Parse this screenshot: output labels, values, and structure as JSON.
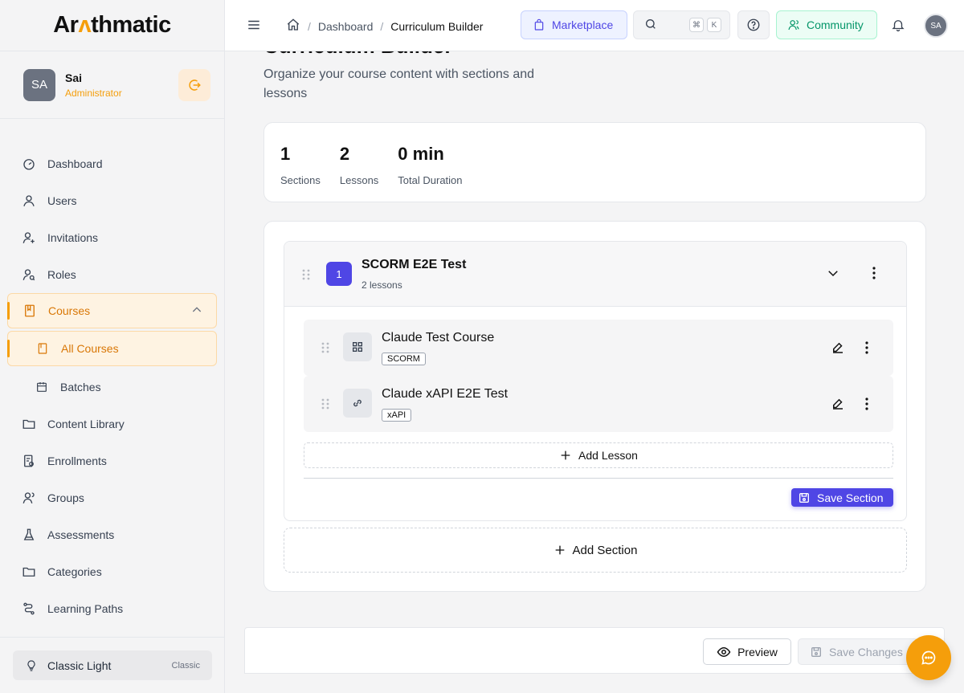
{
  "app": {
    "logo_prefix": "Ar",
    "logo_mark": "ʌ",
    "logo_suffix": "thmatic"
  },
  "profile": {
    "initials": "SA",
    "name": "Sai",
    "role": "Administrator"
  },
  "sidebar": {
    "items": [
      {
        "label": "Dashboard",
        "icon": "dashboard-icon"
      },
      {
        "label": "Users",
        "icon": "user-icon"
      },
      {
        "label": "Invitations",
        "icon": "user-plus-icon"
      },
      {
        "label": "Roles",
        "icon": "roles-icon"
      },
      {
        "label": "Courses",
        "icon": "book-icon"
      },
      {
        "label": "All Courses",
        "icon": "book-icon"
      },
      {
        "label": "Batches",
        "icon": "calendar-icon"
      },
      {
        "label": "Content Library",
        "icon": "folder-icon"
      },
      {
        "label": "Enrollments",
        "icon": "enrollment-icon"
      },
      {
        "label": "Groups",
        "icon": "group-icon"
      },
      {
        "label": "Assessments",
        "icon": "flask-icon"
      },
      {
        "label": "Categories",
        "icon": "folder-icon"
      },
      {
        "label": "Learning Paths",
        "icon": "path-icon"
      }
    ],
    "theme": {
      "label": "Classic Light",
      "tag": "Classic"
    }
  },
  "header": {
    "breadcrumbs": [
      "Dashboard",
      "Curriculum Builder"
    ],
    "marketplace": "Marketplace",
    "kbd1": "⌘",
    "kbd2": "K",
    "community": "Community",
    "avatar": "SA"
  },
  "page": {
    "title": "Curriculum Builder",
    "description": "Organize your course content with sections and lessons"
  },
  "stats": [
    {
      "value": "1",
      "label": "Sections"
    },
    {
      "value": "2",
      "label": "Lessons"
    },
    {
      "value": "0 min",
      "label": "Total Duration"
    }
  ],
  "section": {
    "number": "1",
    "title": "SCORM E2E Test",
    "subtitle": "2 lessons",
    "lessons": [
      {
        "title": "Claude Test Course",
        "type": "SCORM",
        "icon": "grid-icon"
      },
      {
        "title": "Claude xAPI E2E Test",
        "type": "xAPI",
        "icon": "link-icon"
      }
    ],
    "add_lesson": "Add Lesson",
    "save": "Save Section"
  },
  "add_section": "Add Section",
  "footer": {
    "preview": "Preview",
    "save_changes": "Save Changes"
  },
  "colors": {
    "accent": "#f59e0b",
    "primary": "#4f46e5",
    "success": "#059669"
  }
}
